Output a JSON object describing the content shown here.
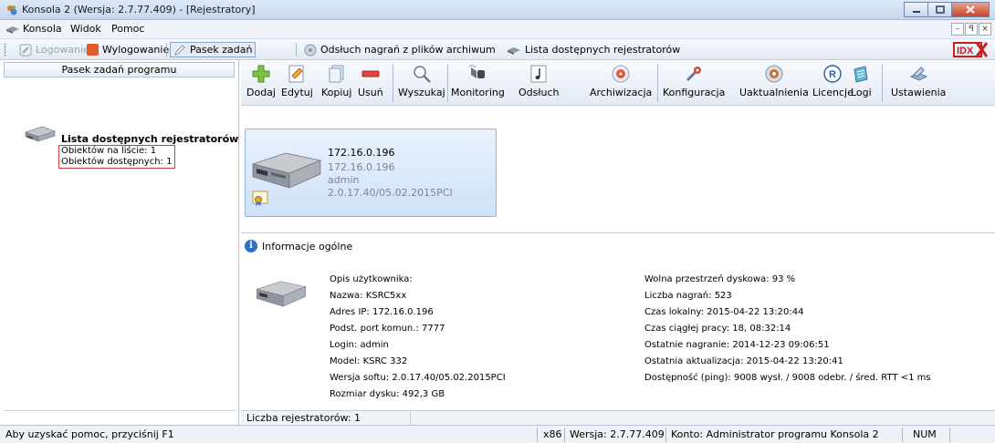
{
  "window": {
    "title": "Konsola 2 (Wersja:  2.7.77.409) - [Rejestratory]"
  },
  "menu": {
    "items": [
      "Konsola",
      "Widok",
      "Pomoc"
    ],
    "mdi_min": "–",
    "mdi_restore": "ꟼ",
    "mdi_close": "×"
  },
  "toolbar1": {
    "login": "Logowanie",
    "logout": "Wylogowanie",
    "taskbar": "Pasek zadań",
    "playback": "Odsłuch nagrań z plików archiwum",
    "recorders": "Lista dostępnych rejestratorów",
    "brand": "IDX"
  },
  "left_panel": {
    "header": "Pasek zadań programu",
    "title": "Lista dostępnych rejestratorów",
    "on_list": "Obiektów na liście: 1",
    "available": "Obiektów dostępnych: 1"
  },
  "main_toolbar": {
    "buttons": [
      {
        "label": "Dodaj",
        "icon": "add-icon"
      },
      {
        "label": "Edytuj",
        "icon": "edit-icon"
      },
      {
        "label": "Kopiuj",
        "icon": "copy-icon"
      },
      {
        "label": "Usuń",
        "icon": "delete-icon"
      },
      {
        "label": "Wyszukaj",
        "icon": "search-icon"
      },
      {
        "label": "Monitoring",
        "icon": "monitoring-icon"
      },
      {
        "label": "Odsłuch",
        "icon": "playback-icon"
      },
      {
        "label": "Archiwizacja",
        "icon": "archive-icon"
      },
      {
        "label": "Konfiguracja",
        "icon": "configuration-icon"
      },
      {
        "label": "Uaktualnienia",
        "icon": "update-icon"
      },
      {
        "label": "Licencje",
        "icon": "license-icon"
      },
      {
        "label": "Logi",
        "icon": "logs-icon"
      },
      {
        "label": "Ustawienia",
        "icon": "settings-icon"
      }
    ]
  },
  "device_card": {
    "name": "172.16.0.196",
    "ip": "172.16.0.196",
    "login": "admin",
    "version": "2.0.17.40/05.02.2015PCI"
  },
  "info": {
    "header": "Informacje ogólne",
    "left": [
      "Opis użytkownika:",
      "Nazwa: KSRC5xx",
      "Adres IP: 172.16.0.196",
      "Podst. port komun.: 7777",
      "Login: admin",
      "Model: KSRC 332",
      "Wersja softu: 2.0.17.40/05.02.2015PCI",
      "Rozmiar dysku: 492,3 GB"
    ],
    "right": [
      "Wolna przestrzeń dyskowa: 93 %",
      "Liczba nagrań: 523",
      "Czas lokalny: 2015-04-22 13:20:44",
      "Czas ciągłej pracy: 18, 08:32:14",
      "Ostatnie nagranie: 2014-12-23 09:06:51",
      "Ostatnia aktualizacja: 2015-04-22 13:20:41",
      "Dostępność (ping): 9008 wysł. / 9008 odebr. / śred. RTT <1 ms"
    ]
  },
  "count_bar": "Liczba rejestratorów: 1",
  "statusbar": {
    "help": "Aby uzyskać pomoc, przyciśnij F1",
    "arch": "x86",
    "version": "Wersja: 2.7.77.409",
    "account": "Konto: Administrator programu Konsola 2",
    "num": "NUM"
  }
}
